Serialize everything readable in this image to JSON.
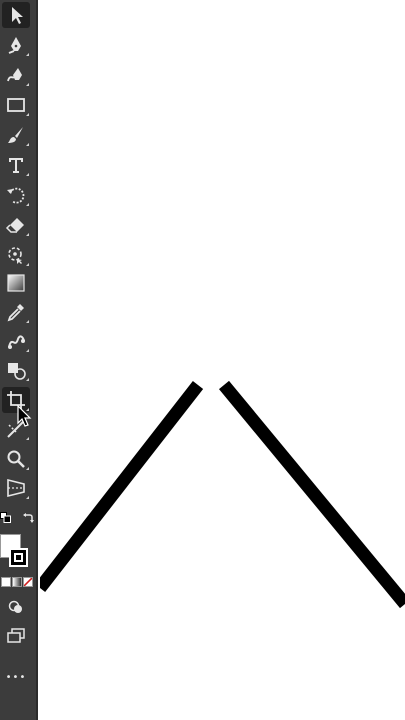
{
  "toolbar": {
    "tools": [
      {
        "name": "selection-tool",
        "icon": "selection-arrow-icon",
        "active": true
      },
      {
        "name": "pen-tool",
        "icon": "pen-icon"
      },
      {
        "name": "curvature-tool",
        "icon": "curvature-pen-icon"
      },
      {
        "name": "rectangle-tool",
        "icon": "rectangle-icon"
      },
      {
        "name": "paintbrush-tool",
        "icon": "paintbrush-icon"
      },
      {
        "name": "type-tool",
        "icon": "type-icon"
      },
      {
        "name": "rotate-tool",
        "icon": "rotate-icon"
      },
      {
        "name": "eraser-tool",
        "icon": "eraser-icon"
      },
      {
        "name": "puppet-warp-tool",
        "icon": "puppet-warp-icon"
      },
      {
        "name": "gradient-tool",
        "icon": "gradient-icon"
      },
      {
        "name": "eyedropper-tool",
        "icon": "eyedropper-icon"
      },
      {
        "name": "blend-tool",
        "icon": "blend-icon"
      },
      {
        "name": "shape-builder-tool",
        "icon": "shape-builder-icon"
      },
      {
        "name": "artboard-tool",
        "icon": "artboard-icon"
      },
      {
        "name": "slice-tool",
        "icon": "slice-icon"
      },
      {
        "name": "zoom-tool",
        "icon": "zoom-icon"
      },
      {
        "name": "perspective-grid-tool",
        "icon": "perspective-icon"
      }
    ],
    "fill_color": "#ffffff",
    "stroke_color": "#000000",
    "more_label": "•••"
  },
  "colors": {
    "toolbar_bg": "#3c3c3c",
    "icon": "#e6e6e6",
    "canvas_bg": "#ffffff",
    "stroke": "#000000"
  }
}
